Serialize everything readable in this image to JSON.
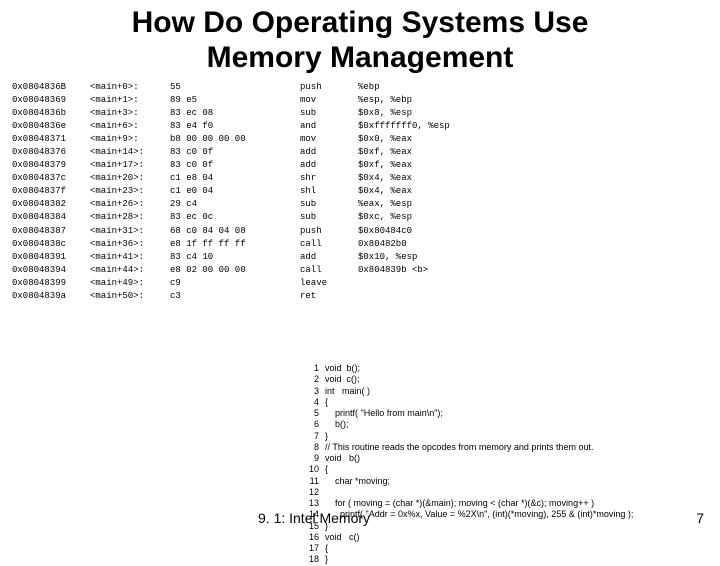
{
  "title_line1": "How Do Operating Systems Use",
  "title_line2": "Memory Management",
  "disasm": [
    {
      "addr": "0x0804836B",
      "loc": "<main+0>:",
      "hex": "55",
      "mnem": "push",
      "args": "%ebp"
    },
    {
      "addr": "0x08048369",
      "loc": "<main+1>:",
      "hex": "89 e5",
      "mnem": "mov",
      "args": "%esp, %ebp"
    },
    {
      "addr": "0x0804836b",
      "loc": "<main+3>:",
      "hex": "83 ec 08",
      "mnem": "sub",
      "args": "$0x8, %esp"
    },
    {
      "addr": "0x0804836e",
      "loc": "<main+6>:",
      "hex": "83 e4 f0",
      "mnem": "and",
      "args": "$0xfffffff0, %esp"
    },
    {
      "addr": "0x08048371",
      "loc": "<main+9>:",
      "hex": "b8 00 00 00 00",
      "mnem": "mov",
      "args": "$0x0, %eax"
    },
    {
      "addr": "0x08048376",
      "loc": "<main+14>:",
      "hex": "83 c0 0f",
      "mnem": "add",
      "args": "$0xf, %eax"
    },
    {
      "addr": "0x08048379",
      "loc": "<main+17>:",
      "hex": "83 c0 0f",
      "mnem": "add",
      "args": "$0xf, %eax"
    },
    {
      "addr": "0x0804837c",
      "loc": "<main+20>:",
      "hex": "c1 e8 04",
      "mnem": "shr",
      "args": "$0x4, %eax"
    },
    {
      "addr": "0x0804837f",
      "loc": "<main+23>:",
      "hex": "c1 e0 04",
      "mnem": "shl",
      "args": "$0x4, %eax"
    },
    {
      "addr": "0x08048382",
      "loc": "<main+26>:",
      "hex": "29 c4",
      "mnem": "sub",
      "args": "%eax, %esp"
    },
    {
      "addr": "0x08048384",
      "loc": "<main+28>:",
      "hex": "83 ec 0c",
      "mnem": "sub",
      "args": "$0xc, %esp"
    },
    {
      "addr": "0x08048387",
      "loc": "<main+31>:",
      "hex": "68 c0 84 04 08",
      "mnem": "push",
      "args": "$0x80484c0"
    },
    {
      "addr": "0x0804838c",
      "loc": "<main+36>:",
      "hex": "e8 1f ff ff ff",
      "mnem": "call",
      "args": "0x80482b0"
    },
    {
      "addr": "0x08048391",
      "loc": "<main+41>:",
      "hex": "83 c4 10",
      "mnem": "add",
      "args": "$0x10, %esp"
    },
    {
      "addr": "0x08048394",
      "loc": "<main+44>:",
      "hex": "e8 02 00 00 00",
      "mnem": "call",
      "args": "0x804839b <b>"
    },
    {
      "addr": "0x08048399",
      "loc": "<main+49>:",
      "hex": "c9",
      "mnem": "leave",
      "args": ""
    },
    {
      "addr": "0x0804839a",
      "loc": "<main+50>:",
      "hex": "c3",
      "mnem": "ret",
      "args": ""
    }
  ],
  "source": [
    {
      "n": "1",
      "c": "void  b();"
    },
    {
      "n": "2",
      "c": "void  c();"
    },
    {
      "n": "3",
      "c": "int   main( )"
    },
    {
      "n": "4",
      "c": "{"
    },
    {
      "n": "5",
      "c": "    printf( \"Hello from main\\n\");"
    },
    {
      "n": "6",
      "c": "    b();"
    },
    {
      "n": "7",
      "c": "}"
    },
    {
      "n": "8",
      "c": "// This routine reads the opcodes from memory and prints them out."
    },
    {
      "n": "9",
      "c": "void   b()"
    },
    {
      "n": "10",
      "c": "{"
    },
    {
      "n": "11",
      "c": "    char *moving;"
    },
    {
      "n": "12",
      "c": ""
    },
    {
      "n": "13",
      "c": "    for ( moving = (char *)(&main); moving < (char *)(&c); moving++ )"
    },
    {
      "n": "14",
      "c": "      printf( \"Addr = 0x%x, Value = %2X\\n\", (int)(*moving), 255 & (int)*moving );"
    },
    {
      "n": "15",
      "c": "}"
    },
    {
      "n": "16",
      "c": "void   c()"
    },
    {
      "n": "17",
      "c": "{"
    },
    {
      "n": "18",
      "c": "}"
    }
  ],
  "footer_left": "9. 1: Intel Memory",
  "footer_right": "7"
}
